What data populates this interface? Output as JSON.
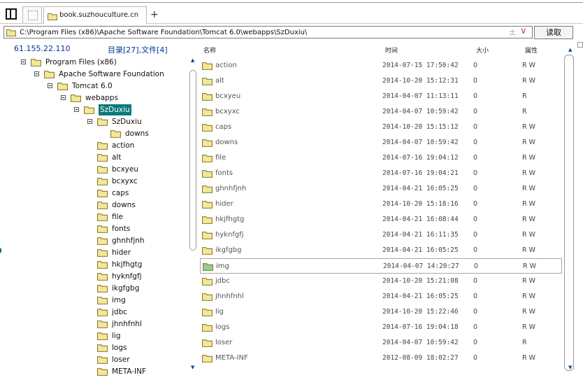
{
  "browser": {
    "tab_label": "book.suzhouculture.cn",
    "new_tab_symbol": "+"
  },
  "address_bar": {
    "path": "C:\\Program Files (x86)\\Apache Software Foundation\\Tomcat 6.0\\webapps\\SzDuxiu\\",
    "plus_minus": "±",
    "chevron": "∨",
    "read_button": "读取"
  },
  "left_panel": {
    "ip": "61.155.22.110",
    "counts": "目录[27],文件[4]",
    "tree": [
      {
        "label": "Program Files (x86)",
        "depth": 0,
        "toggle": true
      },
      {
        "label": "Apache Software Foundation",
        "depth": 1,
        "toggle": true
      },
      {
        "label": "Tomcat 6.0",
        "depth": 2,
        "toggle": true
      },
      {
        "label": "webapps",
        "depth": 3,
        "toggle": true
      },
      {
        "label": "SzDuxiu",
        "depth": 4,
        "toggle": true,
        "selected": true
      },
      {
        "label": "SzDuxiu",
        "depth": 5,
        "toggle": true
      },
      {
        "label": "downs",
        "depth": 6,
        "toggle": false
      },
      {
        "label": "action",
        "depth": 5,
        "toggle": false
      },
      {
        "label": "alt",
        "depth": 5,
        "toggle": false
      },
      {
        "label": "bcxyeu",
        "depth": 5,
        "toggle": false
      },
      {
        "label": "bcxyxc",
        "depth": 5,
        "toggle": false
      },
      {
        "label": "caps",
        "depth": 5,
        "toggle": false
      },
      {
        "label": "downs",
        "depth": 5,
        "toggle": false
      },
      {
        "label": "file",
        "depth": 5,
        "toggle": false
      },
      {
        "label": "fonts",
        "depth": 5,
        "toggle": false
      },
      {
        "label": "ghnhfjnh",
        "depth": 5,
        "toggle": false
      },
      {
        "label": "hider",
        "depth": 5,
        "toggle": false
      },
      {
        "label": "hkjfhgtg",
        "depth": 5,
        "toggle": false
      },
      {
        "label": "hyknfgfj",
        "depth": 5,
        "toggle": false
      },
      {
        "label": "ikgfgbg",
        "depth": 5,
        "toggle": false
      },
      {
        "label": "img",
        "depth": 5,
        "toggle": false
      },
      {
        "label": "jdbc",
        "depth": 5,
        "toggle": false
      },
      {
        "label": "jhnhfnhl",
        "depth": 5,
        "toggle": false
      },
      {
        "label": "lig",
        "depth": 5,
        "toggle": false
      },
      {
        "label": "logs",
        "depth": 5,
        "toggle": false
      },
      {
        "label": "loser",
        "depth": 5,
        "toggle": false
      },
      {
        "label": "META-INF",
        "depth": 5,
        "toggle": false
      }
    ]
  },
  "file_list": {
    "columns": {
      "name": "名称",
      "time": "时间",
      "size": "大小",
      "attr": "属性"
    },
    "rows": [
      {
        "name": "action",
        "time": "2014-07-15 17:50:42",
        "size": "0",
        "attr": "R W"
      },
      {
        "name": "alt",
        "time": "2014-10-20 15:12:31",
        "size": "0",
        "attr": "R W"
      },
      {
        "name": "bcxyeu",
        "time": "2014-04-07 11:13:11",
        "size": "0",
        "attr": "R"
      },
      {
        "name": "bcxyxc",
        "time": "2014-04-07 10:59:42",
        "size": "0",
        "attr": "R"
      },
      {
        "name": "caps",
        "time": "2014-10-20 15:15:12",
        "size": "0",
        "attr": "R W"
      },
      {
        "name": "downs",
        "time": "2014-04-07 10:59:42",
        "size": "0",
        "attr": "R W"
      },
      {
        "name": "file",
        "time": "2014-07-16 19:04:12",
        "size": "0",
        "attr": "R W"
      },
      {
        "name": "fonts",
        "time": "2014-07-16 19:04:21",
        "size": "0",
        "attr": "R W"
      },
      {
        "name": "ghnhfjnh",
        "time": "2014-04-21 16:05:25",
        "size": "0",
        "attr": "R W"
      },
      {
        "name": "hider",
        "time": "2014-10-20 15:18:16",
        "size": "0",
        "attr": "R W"
      },
      {
        "name": "hkjfhgtg",
        "time": "2014-04-21 16:08:44",
        "size": "0",
        "attr": "R W"
      },
      {
        "name": "hyknfgfj",
        "time": "2014-04-21 16:11:35",
        "size": "0",
        "attr": "R W"
      },
      {
        "name": "ikgfgbg",
        "time": "2014-04-21 16:05:25",
        "size": "0",
        "attr": "R W"
      },
      {
        "name": "img",
        "time": "2014-04-07 14:20:27",
        "size": "0",
        "attr": "R W",
        "highlight": true
      },
      {
        "name": "jdbc",
        "time": "2014-10-20 15:21:08",
        "size": "0",
        "attr": "R W"
      },
      {
        "name": "jhnhfnhl",
        "time": "2014-04-21 16:05:25",
        "size": "0",
        "attr": "R W"
      },
      {
        "name": "lig",
        "time": "2014-10-20 15:22:46",
        "size": "0",
        "attr": "R W"
      },
      {
        "name": "logs",
        "time": "2014-07-16 19:04:18",
        "size": "0",
        "attr": "R W"
      },
      {
        "name": "loser",
        "time": "2014-04-07 10:59:42",
        "size": "0",
        "attr": "R"
      },
      {
        "name": "META-INF",
        "time": "2012-08-09 18:02:27",
        "size": "0",
        "attr": "R W"
      }
    ]
  },
  "icons": {
    "folder": "folder-icon",
    "folder_colors": {
      "fill": "#f3e79a",
      "stroke": "#8a7a2a",
      "green_fill": "#8fd08f"
    },
    "selection_color": "#0a7a7a",
    "link_color": "#003399"
  }
}
